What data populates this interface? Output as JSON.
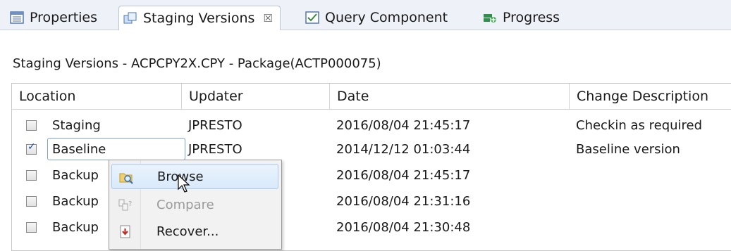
{
  "tabs": [
    {
      "label": "Properties",
      "icon": "properties-icon",
      "active": false
    },
    {
      "label": "Staging Versions",
      "icon": "staging-versions-icon",
      "active": true,
      "close": "☒"
    },
    {
      "label": "Query Component",
      "icon": "query-component-icon",
      "active": false
    },
    {
      "label": "Progress",
      "icon": "progress-icon",
      "active": false
    }
  ],
  "view_title": "Staging Versions - ACPCPY2X.CPY - Package(ACTP000075)",
  "table": {
    "columns": [
      "Location",
      "Updater",
      "Date",
      "Change Description"
    ],
    "rows": [
      {
        "checked": false,
        "location": "Staging",
        "updater": "JPRESTO",
        "date": "2016/08/04 21:45:17",
        "description": "Checkin as required"
      },
      {
        "checked": true,
        "location": "Baseline",
        "updater": "JPRESTO",
        "date": "2014/12/12 01:03:44",
        "description": "Baseline version"
      },
      {
        "checked": false,
        "location": "Backup",
        "updater": "",
        "date": "2016/08/04 21:45:17",
        "description": ""
      },
      {
        "checked": false,
        "location": "Backup",
        "updater": "",
        "date": "2016/08/04 21:31:16",
        "description": ""
      },
      {
        "checked": false,
        "location": "Backup",
        "updater": "",
        "date": "2016/08/04 21:30:48",
        "description": ""
      }
    ]
  },
  "context_menu": {
    "items": [
      {
        "label": "Browse",
        "icon": "browse-icon",
        "enabled": true,
        "hovered": true
      },
      {
        "label": "Compare",
        "icon": "compare-icon",
        "enabled": false
      },
      {
        "label": "Recover...",
        "icon": "recover-icon",
        "enabled": true
      }
    ]
  },
  "colors": {
    "tabbar_bg": "#eef2f8",
    "selection_border": "#7aa2d8",
    "menu_hover": "#d9eafb",
    "disabled_text": "#9a9a9a"
  }
}
